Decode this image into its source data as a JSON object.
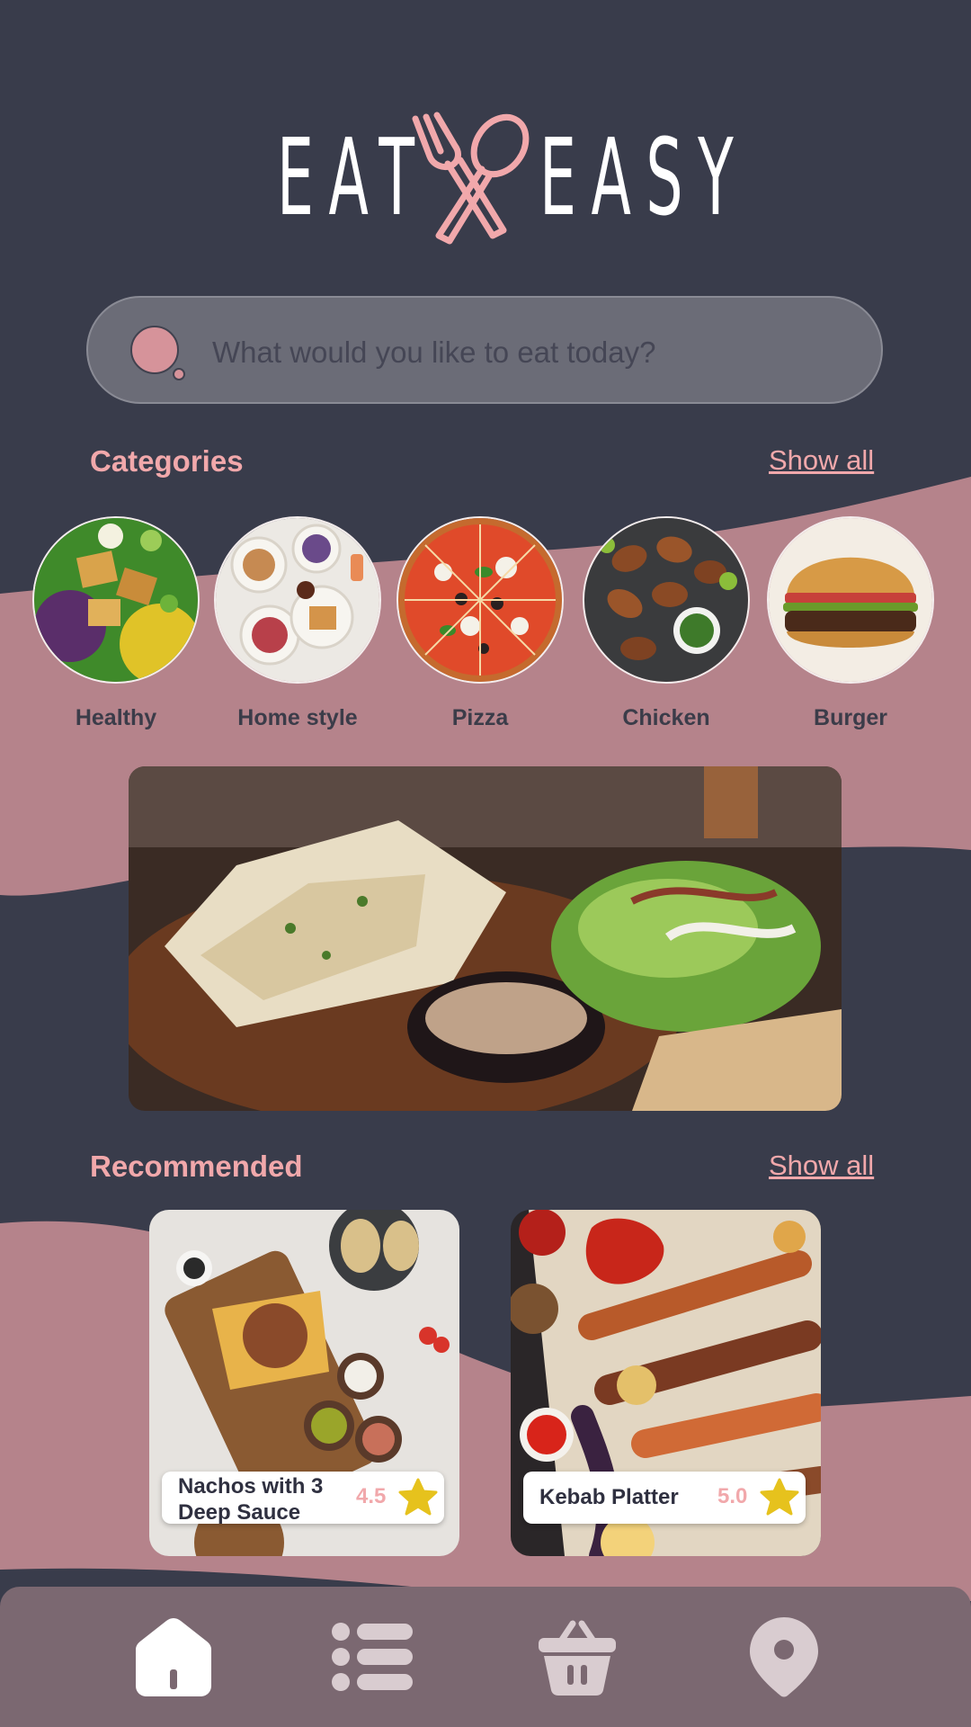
{
  "app": {
    "logo_left": "EAT",
    "logo_right": "EASY",
    "accent_color": "#f1a8ab",
    "background_color": "#393c4b",
    "wave_color": "#b5838b"
  },
  "search": {
    "placeholder": "What would you like to eat today?",
    "icon": "search-icon"
  },
  "categories": {
    "title": "Categories",
    "show_all": "Show all",
    "items": [
      {
        "label": "Healthy"
      },
      {
        "label": "Home style"
      },
      {
        "label": "Pizza"
      },
      {
        "label": "Chicken"
      },
      {
        "label": "Burger"
      }
    ]
  },
  "recommended": {
    "title": "Recommended",
    "show_all": "Show all",
    "items": [
      {
        "name": "Nachos with 3 Deep Sauce",
        "rating": "4.5"
      },
      {
        "name": "Kebab Platter",
        "rating": "5.0"
      }
    ]
  },
  "nav": {
    "items": [
      {
        "icon": "home-icon",
        "active": true
      },
      {
        "icon": "list-icon",
        "active": false
      },
      {
        "icon": "basket-icon",
        "active": false
      },
      {
        "icon": "location-pin-icon",
        "active": false
      }
    ]
  }
}
